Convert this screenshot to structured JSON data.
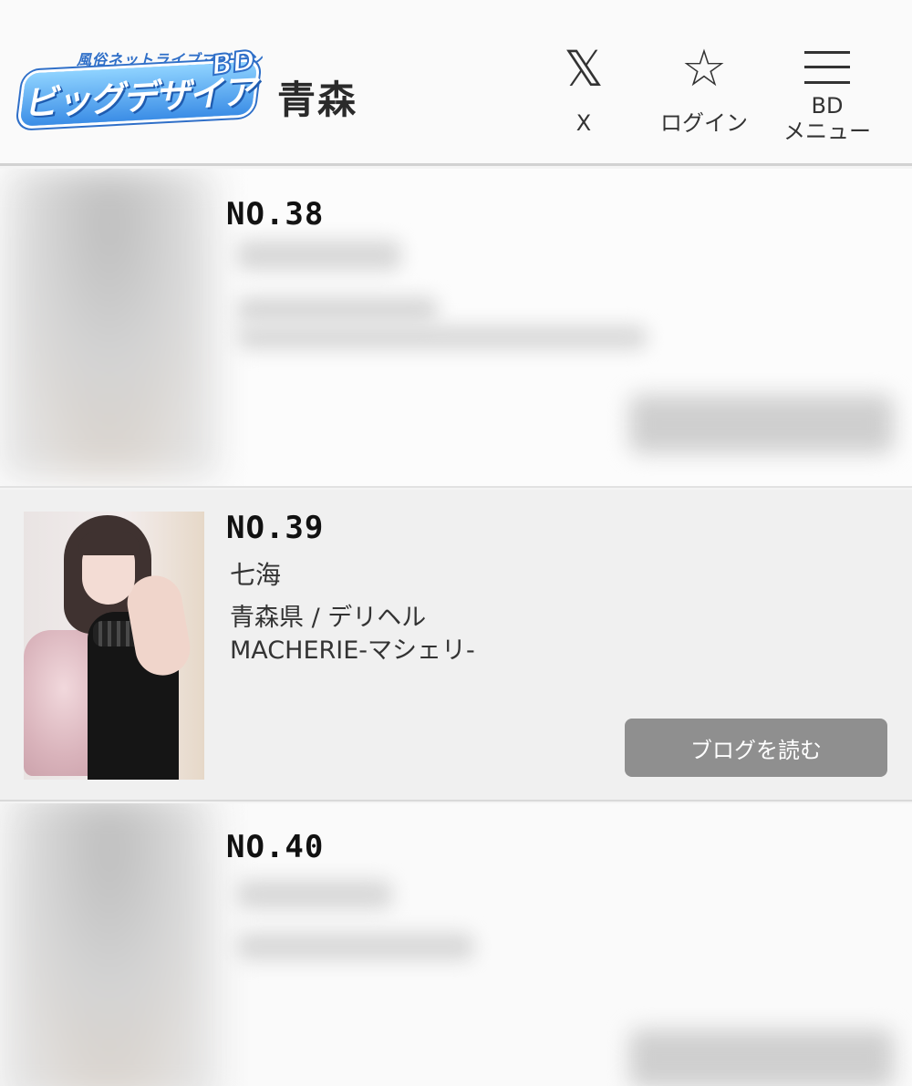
{
  "header": {
    "logo": {
      "small_text": "風俗ネットライブマガジン",
      "main_text": "ビッグデザイア",
      "badge": "BD"
    },
    "region": "青森",
    "nav": {
      "x_label": "X",
      "login_label": "ログイン",
      "menu_label_line1": "BD",
      "menu_label_line2": "メニュー"
    }
  },
  "items": [
    {
      "number": "NO.38"
    },
    {
      "number": "NO.39",
      "name": "七海",
      "area": "青森県 / デリヘル",
      "shop": "MACHERIE-マシェリ-",
      "button": "ブログを読む"
    },
    {
      "number": "NO.40"
    }
  ],
  "colors": {
    "button_bg": "#8f8f8f",
    "logo_blue": "#3b8de6"
  }
}
